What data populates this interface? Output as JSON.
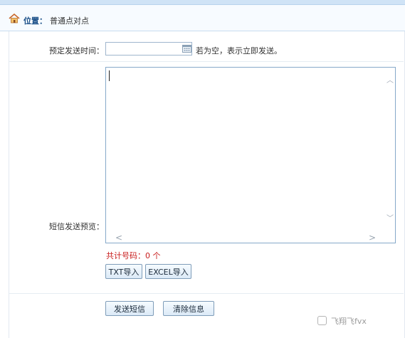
{
  "breadcrumb": {
    "label": "位置：",
    "value": "普通点对点"
  },
  "form": {
    "schedule_label": "预定发送时间：",
    "schedule_value": "",
    "schedule_hint": "若为空，表示立即发送。",
    "preview_label": "短信发送预览：",
    "preview_text": "",
    "count_text": "共计号码：0 个",
    "buttons": {
      "txt_import": "TXT导入",
      "excel_import": "EXCEL导入",
      "send": "发送短信",
      "clear": "清除信息"
    }
  },
  "watermark": {
    "text": "飞翔飞fvx"
  },
  "colors": {
    "accent": "#1a4f88",
    "count_red": "#c81d1d",
    "border_blue": "#86a9c9"
  }
}
